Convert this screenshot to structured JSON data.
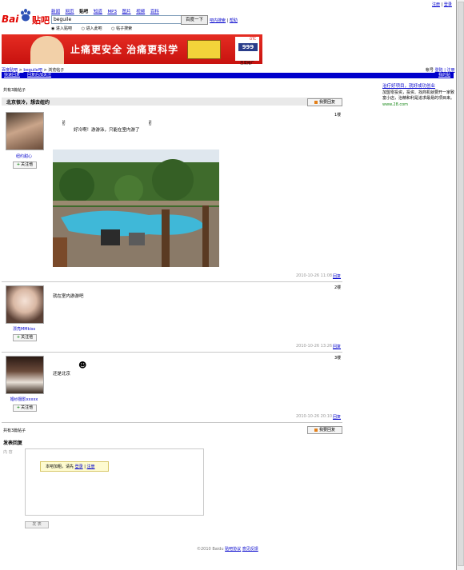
{
  "header": {
    "logo_text_bai": "Bai",
    "logo_text_tieba": "贴吧",
    "nav": [
      {
        "label": "新闻",
        "current": false
      },
      {
        "label": "网页",
        "current": false
      },
      {
        "label": "贴吧",
        "current": true
      },
      {
        "label": "知道",
        "current": false
      },
      {
        "label": "MP3",
        "current": false
      },
      {
        "label": "图片",
        "current": false
      },
      {
        "label": "视频",
        "current": false
      },
      {
        "label": "百科",
        "current": false
      }
    ],
    "search_value": "beguile",
    "search_button": "百度一下",
    "search_links": [
      "吧内搜索",
      "帮助"
    ],
    "radio_options": [
      "进入贴吧",
      "进入此吧",
      "帖子搜索"
    ],
    "top_links": [
      "注册",
      "登录"
    ]
  },
  "banner": {
    "text": "止痛更安全 治痛更科学",
    "logo_number": "999",
    "logo_top": "OTC",
    "caption": "百度推广"
  },
  "breadcrumb": {
    "items": [
      "百度贴吧",
      "beguile吧",
      "浏览帖子"
    ],
    "separator": ">",
    "right_links": [
      "帐号",
      "登陆 | 注册"
    ]
  },
  "bluebar": {
    "left_links": [
      "快速回复",
      "回复后加关注"
    ],
    "right_link": "我的贴吧"
  },
  "thread": {
    "count_top": "共有3篇帖子",
    "count_bottom": "共有3篇帖子",
    "title": "北京很冷，想去纽约",
    "reply_button": "我要回复",
    "posts": [
      {
        "username": "纽约甜心",
        "floor": "1楼",
        "text": "好冷啊！游游泳，只能在室内游了",
        "time": "2010-10-26 11:08",
        "reply": "回复",
        "follow": "关注他"
      },
      {
        "username": "漂亮MMkiss",
        "floor": "2楼",
        "text": "就在室内游游吧",
        "time": "2010-10-26 13:26",
        "reply": "回复",
        "follow": "关注他"
      },
      {
        "username": "婚纱摄影xxxxx",
        "floor": "3楼",
        "text": "还是北京",
        "time": "2010-10-26 20:10",
        "reply": "回复",
        "follow": "关注他"
      }
    ]
  },
  "right_ad": {
    "title": "治疗好项目，就好成功创业",
    "body": "加盟零投资，投资、找商机就要开一家致富小店，治精和利是追求最易的项目来。",
    "url": "www.28.com"
  },
  "reply_form": {
    "heading": "发表回复",
    "side_label": "内 容",
    "tip_text": "本吧加粗，请先",
    "tip_link1": "登录",
    "tip_sep": "|",
    "tip_link2": "注册",
    "submit": "发 表"
  },
  "footer": {
    "copyright": "©2010 Baidu",
    "links": [
      "贴吧协议",
      "意见反馈"
    ]
  },
  "colors": {
    "brand_red": "#e10601",
    "link_blue": "#0000cc",
    "bar_blue": "#0000cc"
  }
}
